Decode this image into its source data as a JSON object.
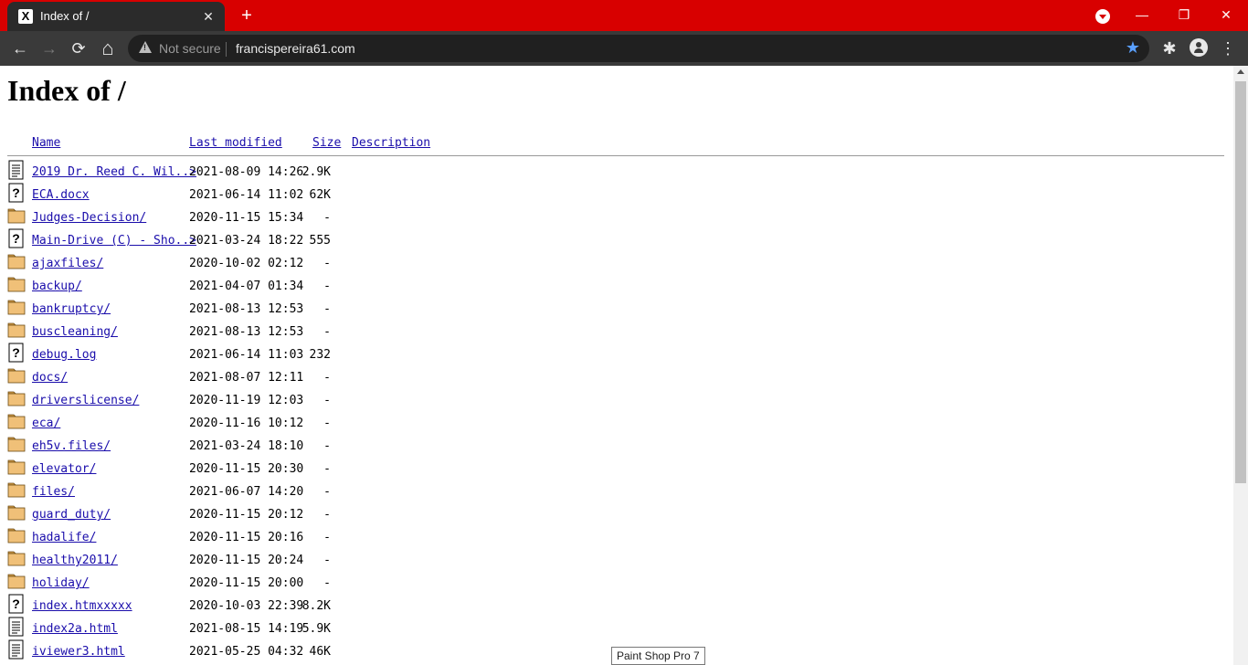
{
  "browser": {
    "tab_title": "Index of /",
    "tab_favicon_letter": "X",
    "new_tab_symbol": "+",
    "tab_close_symbol": "✕",
    "security_label": "Not secure",
    "url": "francispereira61.com",
    "window_controls": {
      "minimize": "—",
      "restore": "❐",
      "close": "✕"
    },
    "toolbar_icons": {
      "back": "←",
      "forward": "→",
      "reload": "⟳",
      "home": "⌂",
      "star": "★",
      "extensions": "✱",
      "menu": "⋮"
    }
  },
  "page": {
    "heading": "Index of /",
    "columns": {
      "name": "Name",
      "modified": "Last modified",
      "size": "Size",
      "description": "Description"
    },
    "entries": [
      {
        "icon": "text",
        "name": "2019 Dr. Reed C. Wil..>",
        "modified": "2021-08-09 14:26",
        "size": "2.9K"
      },
      {
        "icon": "unknown",
        "name": "ECA.docx",
        "modified": "2021-06-14 11:02",
        "size": "62K"
      },
      {
        "icon": "folder",
        "name": "Judges-Decision/",
        "modified": "2020-11-15 15:34",
        "size": "-"
      },
      {
        "icon": "unknown",
        "name": "Main-Drive (C) - Sho..>",
        "modified": "2021-03-24 18:22",
        "size": "555"
      },
      {
        "icon": "folder",
        "name": "ajaxfiles/",
        "modified": "2020-10-02 02:12",
        "size": "-"
      },
      {
        "icon": "folder",
        "name": "backup/",
        "modified": "2021-04-07 01:34",
        "size": "-"
      },
      {
        "icon": "folder",
        "name": "bankruptcy/",
        "modified": "2021-08-13 12:53",
        "size": "-"
      },
      {
        "icon": "folder",
        "name": "buscleaning/",
        "modified": "2021-08-13 12:53",
        "size": "-"
      },
      {
        "icon": "unknown",
        "name": "debug.log",
        "modified": "2021-06-14 11:03",
        "size": "232"
      },
      {
        "icon": "folder",
        "name": "docs/",
        "modified": "2021-08-07 12:11",
        "size": "-"
      },
      {
        "icon": "folder",
        "name": "driverslicense/",
        "modified": "2020-11-19 12:03",
        "size": "-"
      },
      {
        "icon": "folder",
        "name": "eca/",
        "modified": "2020-11-16 10:12",
        "size": "-"
      },
      {
        "icon": "folder",
        "name": "eh5v.files/",
        "modified": "2021-03-24 18:10",
        "size": "-"
      },
      {
        "icon": "folder",
        "name": "elevator/",
        "modified": "2020-11-15 20:30",
        "size": "-"
      },
      {
        "icon": "folder",
        "name": "files/",
        "modified": "2021-06-07 14:20",
        "size": "-"
      },
      {
        "icon": "folder",
        "name": "guard_duty/",
        "modified": "2020-11-15 20:12",
        "size": "-"
      },
      {
        "icon": "folder",
        "name": "hadalife/",
        "modified": "2020-11-15 20:16",
        "size": "-"
      },
      {
        "icon": "folder",
        "name": "healthy2011/",
        "modified": "2020-11-15 20:24",
        "size": "-"
      },
      {
        "icon": "folder",
        "name": "holiday/",
        "modified": "2020-11-15 20:00",
        "size": "-"
      },
      {
        "icon": "unknown",
        "name": "index.htmxxxxx",
        "modified": "2020-10-03 22:39",
        "size": "8.2K"
      },
      {
        "icon": "text",
        "name": "index2a.html",
        "modified": "2021-08-15 14:19",
        "size": "5.9K"
      },
      {
        "icon": "text",
        "name": "iviewer3.html",
        "modified": "2021-05-25 04:32",
        "size": "46K"
      }
    ]
  },
  "tooltip": "Paint Shop Pro 7",
  "colors": {
    "tab_strip": "#d80000",
    "toolbar": "#3a3a3a",
    "link": "#1a0dab",
    "folder": "#f0c078"
  }
}
